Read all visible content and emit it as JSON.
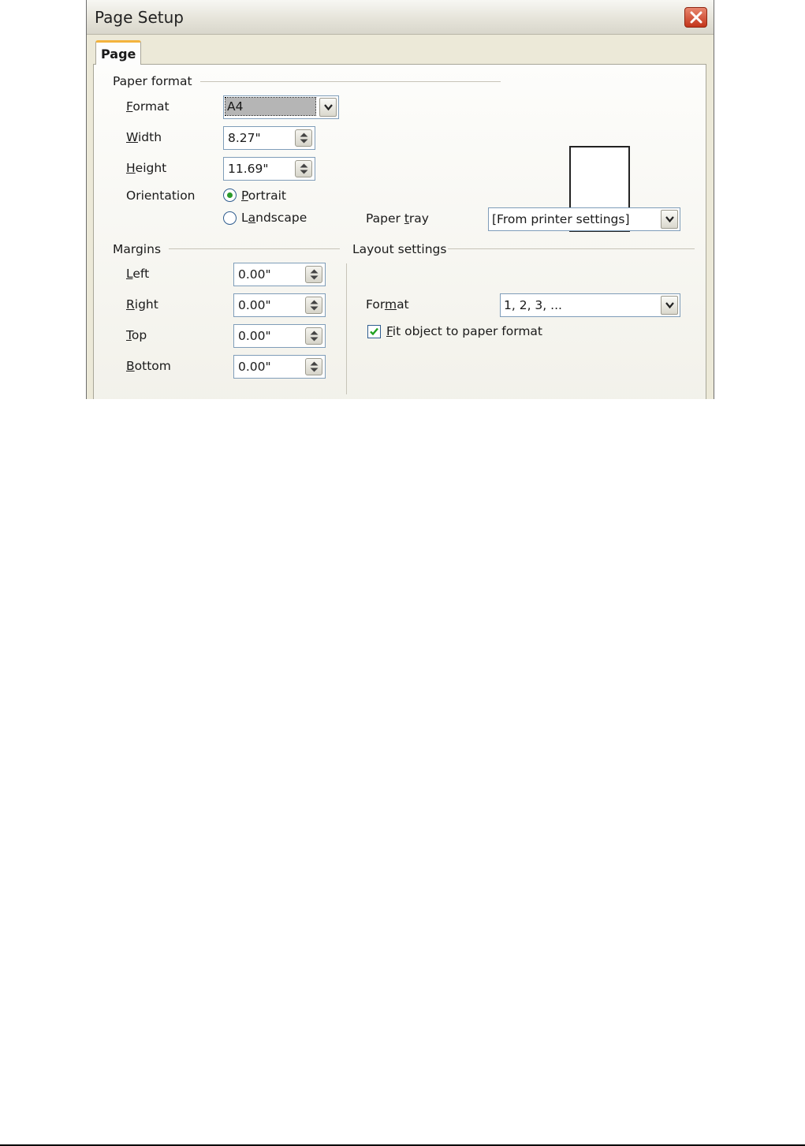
{
  "dialog": {
    "title": "Page Setup",
    "tab_label": "Page"
  },
  "paper_format": {
    "group_label": "Paper format",
    "format_label": {
      "u": "F",
      "rest": "ormat"
    },
    "format_value": "A4",
    "width_label": {
      "u": "W",
      "rest": "idth"
    },
    "width_value": "8.27\"",
    "height_label": {
      "u": "H",
      "rest": "eight"
    },
    "height_value": "11.69\"",
    "orientation_label": "Orientation",
    "portrait_label": {
      "u": "P",
      "rest": "ortrait"
    },
    "landscape_label": {
      "pre": "L",
      "u": "a",
      "rest": "ndscape"
    },
    "orientation_selected": "Portrait",
    "paper_tray_label": {
      "pre": "Paper ",
      "u": "t",
      "rest": "ray"
    },
    "paper_tray_value": "[From printer settings]"
  },
  "margins": {
    "group_label": "Margins",
    "left_label": {
      "u": "L",
      "rest": "eft"
    },
    "left_value": "0.00\"",
    "right_label": {
      "u": "R",
      "rest": "ight"
    },
    "right_value": "0.00\"",
    "top_label": {
      "u": "T",
      "rest": "op"
    },
    "top_value": "0.00\"",
    "bottom_label": {
      "u": "B",
      "rest": "ottom"
    },
    "bottom_value": "0.00\""
  },
  "layout_settings": {
    "group_label": "Layout settings",
    "format_label": {
      "pre": "For",
      "u": "m",
      "rest": "at"
    },
    "format_value": "1, 2, 3, ...",
    "fit_label": {
      "u": "F",
      "rest": "it object to paper format"
    },
    "fit_checked": true
  },
  "icons": {
    "close": "close-icon",
    "dropdown": "chevron-down-icon",
    "spin": "spin-arrows-icon",
    "check": "checkmark-icon"
  }
}
